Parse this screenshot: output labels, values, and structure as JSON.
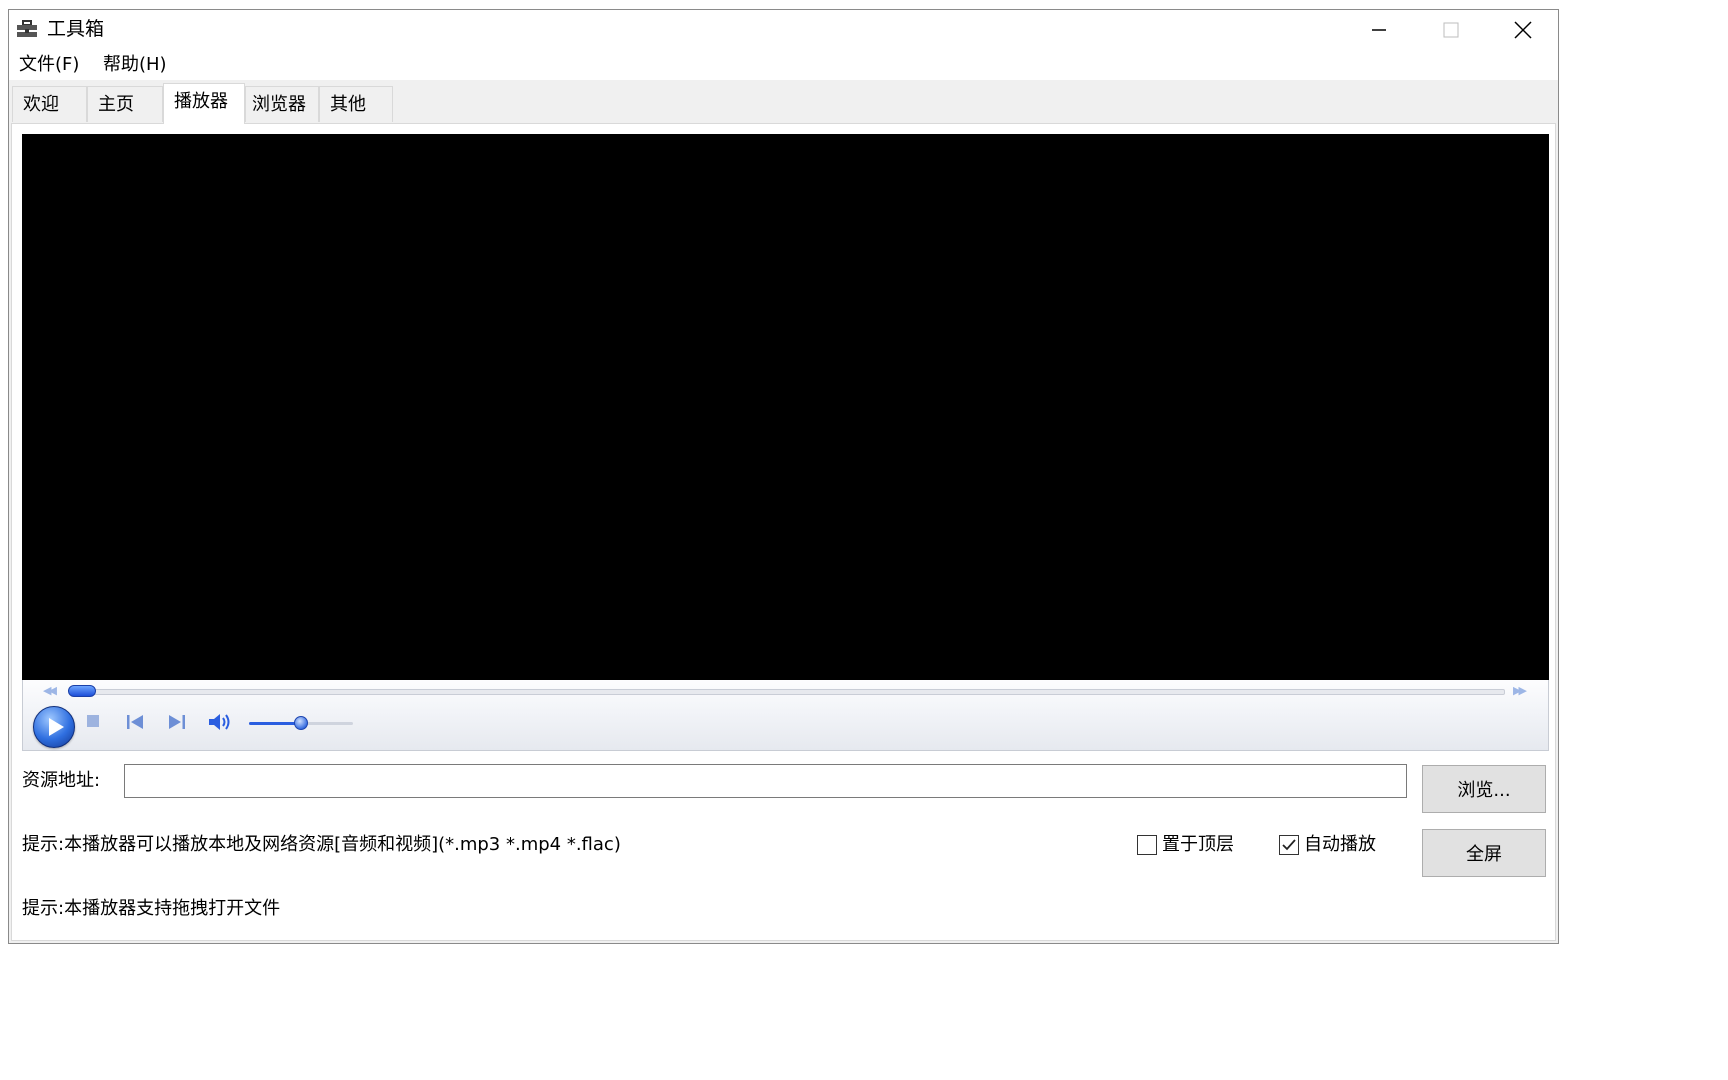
{
  "window": {
    "title": "工具箱",
    "icon": "toolbox-icon",
    "controls": [
      "minimize",
      "maximize",
      "close"
    ]
  },
  "menu": {
    "items": [
      {
        "label": "文件(F)"
      },
      {
        "label": "帮助(H)"
      }
    ]
  },
  "tabs": [
    {
      "label": "欢迎",
      "active": false
    },
    {
      "label": "主页",
      "active": false
    },
    {
      "label": "播放器",
      "active": true
    },
    {
      "label": "浏览器",
      "active": false
    },
    {
      "label": "其他",
      "active": false
    }
  ],
  "player": {
    "seek_position": 0.0,
    "volume": 0.5,
    "icons": [
      "rewind-icon",
      "play-icon",
      "stop-icon",
      "previous-icon",
      "next-icon",
      "volume-icon",
      "fast-forward-icon"
    ]
  },
  "form": {
    "source_label": "资源地址:",
    "source_value": "",
    "browse_label": "浏览...",
    "hint1": "提示:本播放器可以播放本地及网络资源[音频和视频](*.mp3 *.mp4 *.flac)",
    "hint2": "提示:本播放器支持拖拽打开文件",
    "topmost_label": "置于顶层",
    "topmost_checked": false,
    "autoplay_label": "自动播放",
    "autoplay_checked": true,
    "fullscreen_label": "全屏"
  }
}
